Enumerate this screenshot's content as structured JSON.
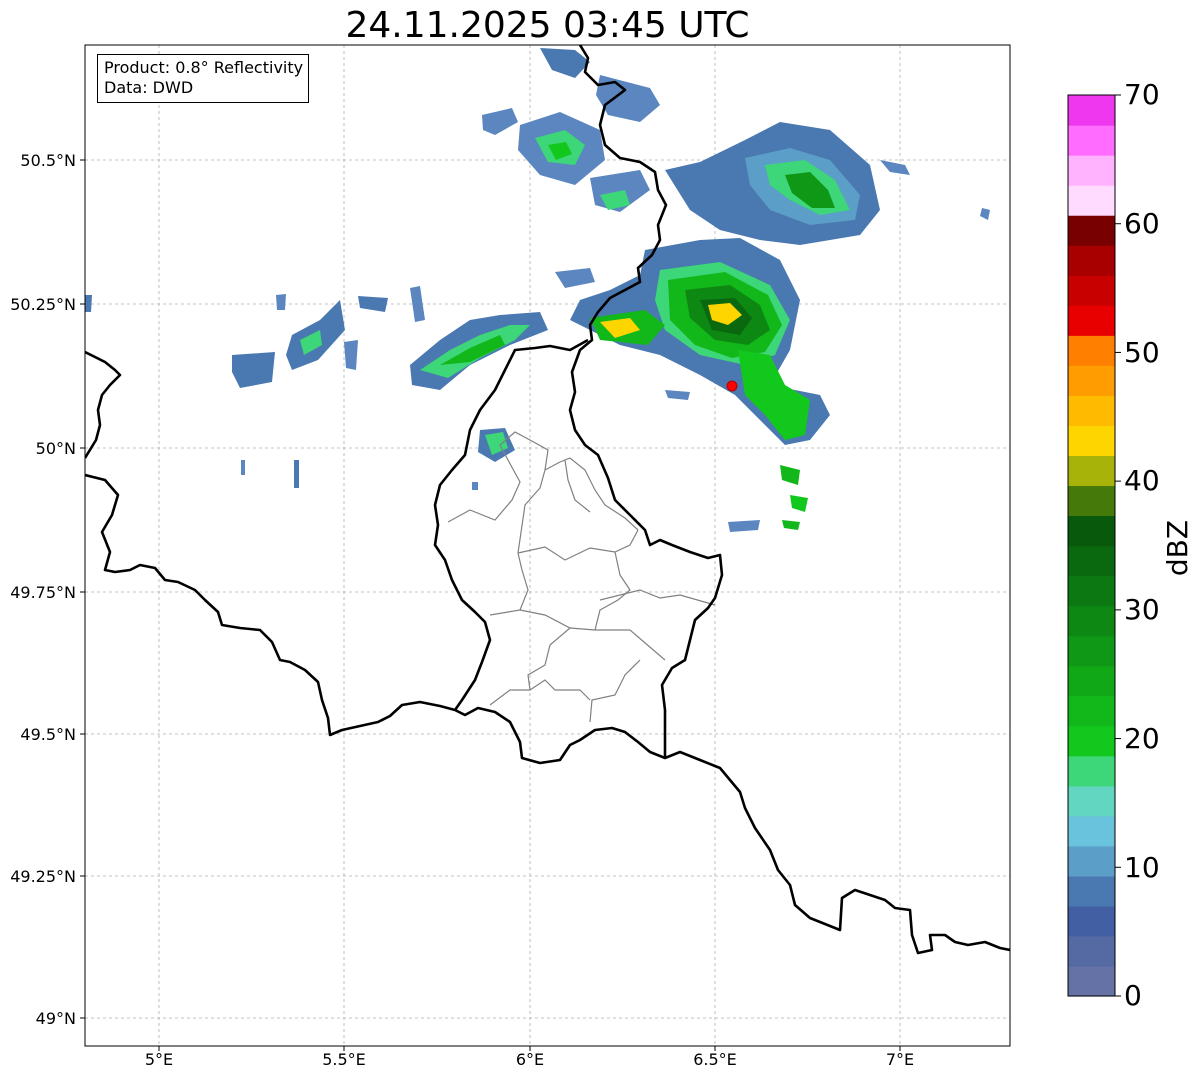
{
  "title": "24.11.2025 03:45 UTC",
  "info_box": {
    "product": "Product: 0.8° Reflectivity",
    "data": "Data: DWD"
  },
  "lat_labels": [
    "50.5°N",
    "50.25°N",
    "50°N",
    "49.75°N",
    "49.5°N",
    "49.25°N",
    "49°N"
  ],
  "lon_labels": [
    "5°E",
    "5.5°E",
    "6°E",
    "6.5°E",
    "7°E"
  ],
  "colorbar": {
    "unit_label": "dBZ",
    "range": [
      0,
      70
    ],
    "ticks": [
      "0",
      "10",
      "20",
      "30",
      "40",
      "50",
      "60",
      "70"
    ],
    "colors": [
      "#6472a6",
      "#556aa3",
      "#435fa3",
      "#4a78b0",
      "#5b9ec8",
      "#6ac3dc",
      "#63d6c2",
      "#3dd678",
      "#13c81d",
      "#12b81a",
      "#10a817",
      "#0e9815",
      "#0d8813",
      "#0b7811",
      "#0a680f",
      "#09590d",
      "#457a0a",
      "#a8b30a",
      "#ffd500",
      "#ffbb00",
      "#ff9d00",
      "#ff7f00",
      "#e80000",
      "#c80000",
      "#a80000",
      "#780000",
      "#ffdbff",
      "#ffb3ff",
      "#ff6cff",
      "#ee37ee"
    ]
  },
  "map": {
    "lon_range": [
      4.8,
      7.3
    ],
    "lat_range": [
      48.95,
      50.7
    ],
    "marker_color": "#ff0000",
    "border_color": "#000000",
    "district_color": "#808080",
    "grid_color": "#b0b0b0"
  }
}
